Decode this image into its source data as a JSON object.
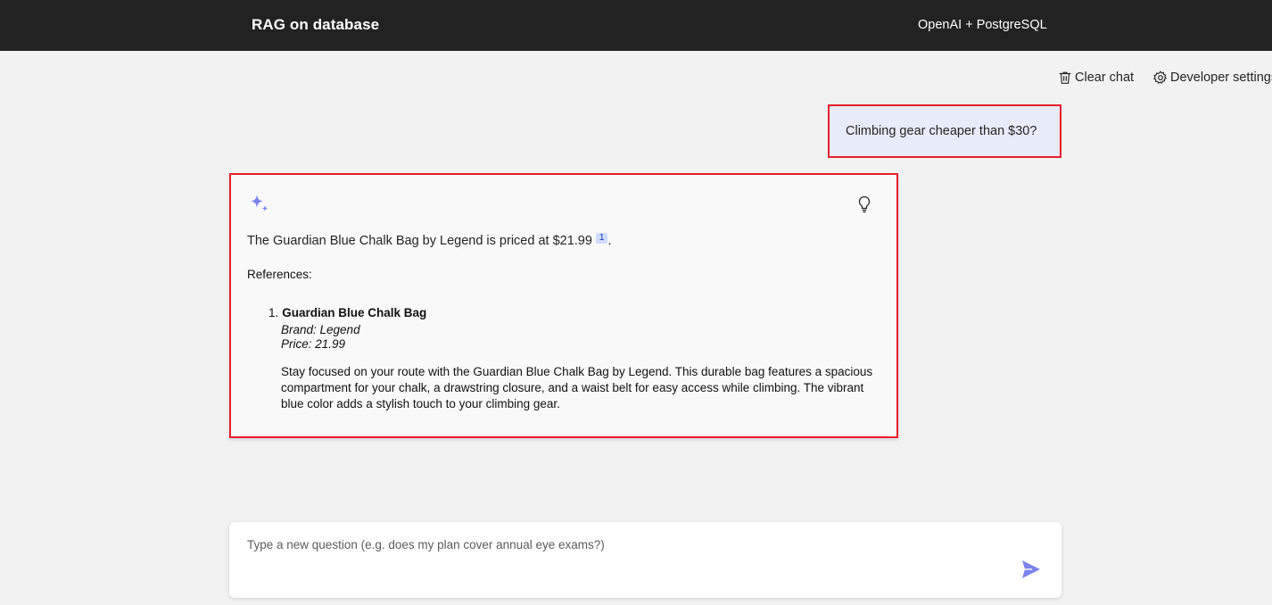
{
  "header": {
    "title": "RAG on database",
    "subtitle": "OpenAI + PostgreSQL"
  },
  "commands": {
    "clear_chat": "Clear chat",
    "developer_settings": "Developer settings"
  },
  "chat": {
    "user_question": "Climbing gear cheaper than $30?",
    "answer": {
      "text": "The Guardian Blue Chalk Bag by Legend is priced at $21.99",
      "citation": "1",
      "trailing": ".",
      "references_heading": "References:",
      "references": [
        {
          "number": "1.",
          "title": "Guardian Blue Chalk Bag",
          "brand": "Brand: Legend",
          "price": "Price: 21.99",
          "description": "Stay focused on your route with the Guardian Blue Chalk Bag by Legend. This durable bag features a spacious compartment for your chalk, a drawstring closure, and a waist belt for easy access while climbing. The vibrant blue color adds a stylish touch to your climbing gear."
        }
      ]
    }
  },
  "composer": {
    "placeholder": "Type a new question (e.g. does my plan cover annual eye exams?)",
    "value": ""
  },
  "colors": {
    "header_bg": "#222222",
    "accent": "#7b83eb",
    "user_bubble_bg": "#e8ebfa",
    "highlight_border": "#e81c2b"
  },
  "icons": {
    "clear": "trash-icon",
    "settings": "gear-icon",
    "assistant": "sparkle-icon",
    "thought": "lightbulb-icon",
    "send": "send-icon"
  }
}
